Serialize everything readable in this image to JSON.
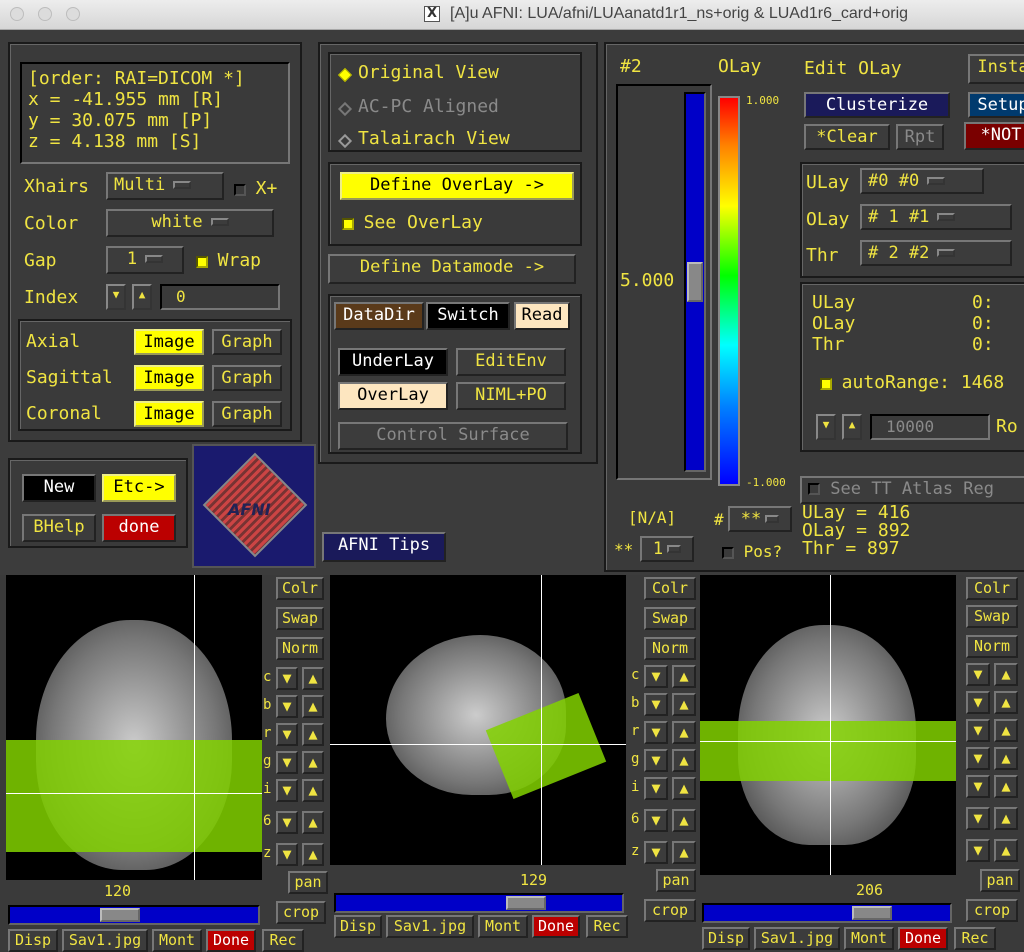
{
  "window": {
    "title": "[A]u AFNI: LUA/afni/LUAanatd1r1_ns+orig & LUAd1r6_card+orig"
  },
  "coords": {
    "order": "[order: RAI=DICOM *]",
    "x": "x =  -41.955 mm [R]",
    "y": "y =   30.075 mm [P]",
    "z": "z =    4.138 mm [S]"
  },
  "xhairs": {
    "label": "Xhairs",
    "value": "Multi",
    "xplus": "X+"
  },
  "color": {
    "label": "Color",
    "value": "white"
  },
  "gap": {
    "label": "Gap",
    "value": "1",
    "wrap": "Wrap"
  },
  "index": {
    "label": "Index",
    "value": "0"
  },
  "views": [
    {
      "name": "Axial",
      "image": "Image",
      "graph": "Graph"
    },
    {
      "name": "Sagittal",
      "image": "Image",
      "graph": "Graph"
    },
    {
      "name": "Coronal",
      "image": "Image",
      "graph": "Graph"
    }
  ],
  "bottom_left": {
    "new": "New",
    "etc": "Etc->",
    "bhelp": "BHelp",
    "done": "done",
    "logo": "AFNI"
  },
  "view_mode": {
    "original": "Original View",
    "acpc": "AC-PC Aligned",
    "talairach": "Talairach View"
  },
  "overlay": {
    "define": "Define OverLay ->",
    "see": "See OverLay"
  },
  "datamode": {
    "define": "Define Datamode ->"
  },
  "data_buttons": {
    "datadir": "DataDir",
    "switch": "Switch",
    "read": "Read",
    "underlay": "UnderLay",
    "editenv": "EditEnv",
    "overlay": "OverLay",
    "niml": "NIML+PO",
    "control_surface": "Control Surface"
  },
  "tips": "AFNI Tips",
  "olay_panel": {
    "num": "#2",
    "olay_title": "OLay",
    "edit_olay": "Edit OLay",
    "insta": "Insta",
    "clusterize": "Clusterize",
    "setup": "Setup",
    "clear": "*Clear",
    "rpt": "Rpt",
    "not": "*NOT",
    "slider_value": "5.000",
    "cbar_max": "1.000",
    "cbar_min": "-1.000",
    "na": "[N/A]",
    "hash": "#",
    "hash_value": "**",
    "pow_value": "1",
    "pos": "Pos?",
    "ulay_sel": {
      "label": "ULay",
      "value": "#0 #0"
    },
    "olay_sel": {
      "label": "OLay",
      "value": "#  1 #1"
    },
    "thr_sel": {
      "label": "Thr",
      "value": "#  2 #2"
    },
    "vals": [
      {
        "k": "ULay",
        "v": "0:"
      },
      {
        "k": "OLay",
        "v": "0:"
      },
      {
        "k": "Thr",
        "v": "0:"
      }
    ],
    "autorange": "autoRange: 1468",
    "range_value": "10000",
    "ro": "Ro",
    "see_tt": "See TT Atlas Reg",
    "info": [
      "ULay = 416",
      "OLay = 892",
      "Thr  = 897"
    ]
  },
  "image_windows": [
    {
      "slice": "120"
    },
    {
      "slice": "129"
    },
    {
      "slice": "206"
    }
  ],
  "img_side": {
    "colr": "Colr",
    "swap": "Swap",
    "norm": "Norm",
    "pan": "pan",
    "crop": "crop"
  },
  "img_bottom": {
    "disp": "Disp",
    "sav": "Sav1.jpg",
    "mont": "Mont",
    "done": "Done",
    "rec": "Rec"
  },
  "side_letters": [
    "c",
    "b",
    "r",
    "g",
    "i",
    "6",
    "z"
  ],
  "colors": {
    "yellow": "#f0e442",
    "bright_yellow": "#ffff00",
    "slider_blue": "#0000c8",
    "overlay_green": "#82d200",
    "done_red": "#bb0000"
  }
}
